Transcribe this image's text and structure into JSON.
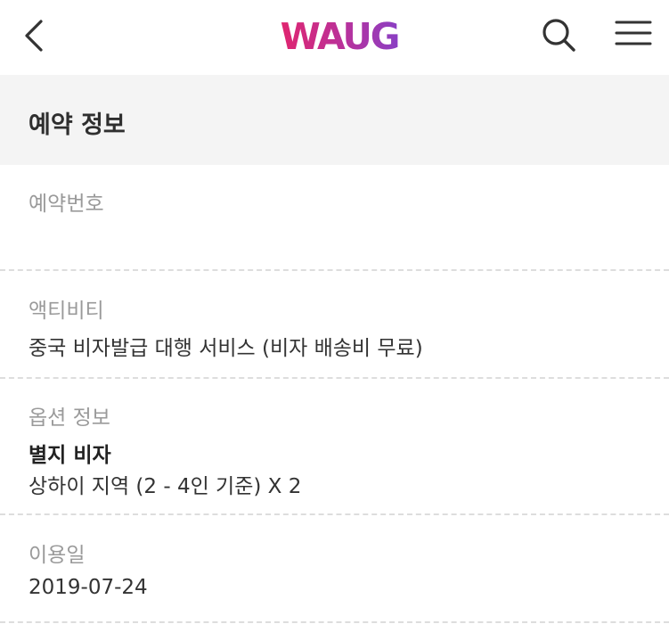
{
  "header": {
    "back_icon": "chevron-left-icon",
    "logo_text": "WAUG",
    "logo_colors": [
      "#e0256f",
      "#b8329c",
      "#8a3fc4"
    ],
    "search_icon": "search-icon",
    "menu_icon": "hamburger-menu-icon"
  },
  "section": {
    "title": "예약 정보"
  },
  "reservation": {
    "number_label": "예약번호",
    "number_value": "",
    "activity_label": "액티비티",
    "activity_value": "중국 비자발급 대행 서비스 (비자 배송비 무료)",
    "option_label": "옵션 정보",
    "option_title": "별지 비자",
    "option_detail": "상하이 지역 (2 - 4인 기준) X 2",
    "date_label": "이용일",
    "date_value": "2019-07-24"
  },
  "colors": {
    "section_bg": "#f4f4f4",
    "label_gray": "#9a9a9a",
    "text_dark": "#333333"
  }
}
